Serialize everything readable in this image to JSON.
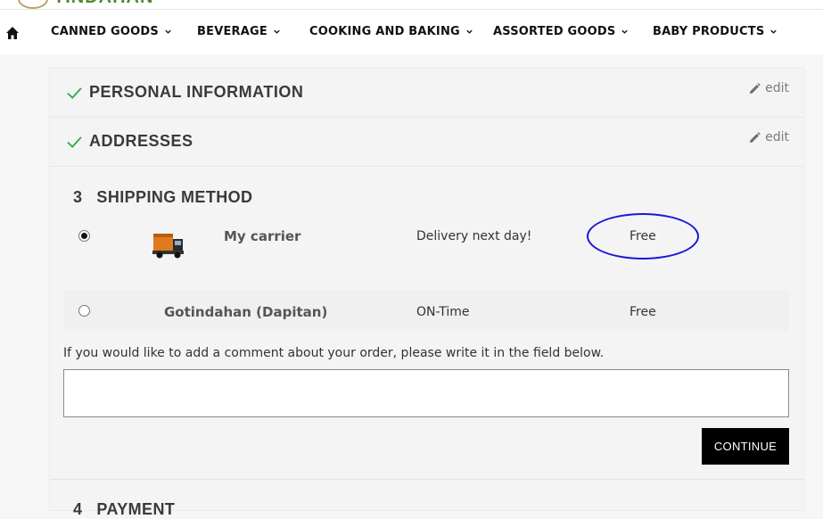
{
  "brand": {
    "name": "TINDAHAN"
  },
  "nav": {
    "items": [
      {
        "label": "CANNED GOODS"
      },
      {
        "label": "BEVERAGE"
      },
      {
        "label": "COOKING AND BAKING"
      },
      {
        "label": "ASSORTED GOODS"
      },
      {
        "label": "BABY PRODUCTS"
      }
    ]
  },
  "steps": {
    "personal": {
      "title": "PERSONAL INFORMATION",
      "edit_label": "edit"
    },
    "addresses": {
      "title": "ADDRESSES",
      "edit_label": "edit"
    },
    "shipping": {
      "number": "3",
      "title": "SHIPPING METHOD"
    },
    "payment": {
      "number": "4",
      "title": "PAYMENT"
    }
  },
  "carriers": [
    {
      "name": "My carrier",
      "delay": "Delivery next day!",
      "price": "Free",
      "selected": true
    },
    {
      "name": "Gotindahan (Dapitan)",
      "delay": "ON-Time",
      "price": "Free",
      "selected": false
    }
  ],
  "comment": {
    "label": "If you would like to add a comment about your order, please write it in the field below.",
    "value": ""
  },
  "continue_label": "CONTINUE",
  "colors": {
    "check": "#2fae4e",
    "annotation": "#1a17d8",
    "button": "#000000"
  }
}
